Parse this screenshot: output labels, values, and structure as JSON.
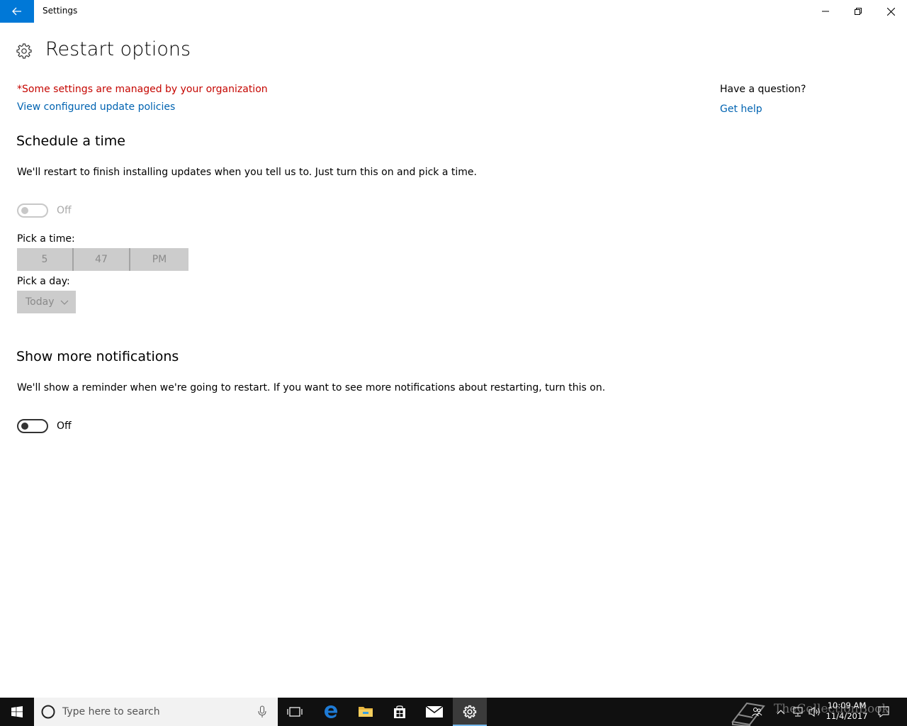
{
  "window": {
    "title": "Settings"
  },
  "page": {
    "title": "Restart options"
  },
  "policy": {
    "managed_note": "*Some settings are managed by your organization",
    "view_policies_link": "View configured update policies"
  },
  "schedule": {
    "heading": "Schedule a time",
    "description": "We'll restart to finish installing updates when you tell us to. Just turn this on and pick a time.",
    "toggle_state": "Off",
    "pick_time_label": "Pick a time:",
    "time": {
      "hour": "5",
      "minute": "47",
      "ampm": "PM"
    },
    "pick_day_label": "Pick a day:",
    "day": "Today"
  },
  "notifications": {
    "heading": "Show more notifications",
    "description": "We'll show a reminder when we're going to restart. If you want to see more notifications about restarting, turn this on.",
    "toggle_state": "Off"
  },
  "help": {
    "question": "Have a question?",
    "get_help_link": "Get help"
  },
  "taskbar": {
    "search_placeholder": "Type here to search",
    "clock_time": "10:09 AM",
    "clock_date": "11/4/2017",
    "watermark": "TheCollectionBook",
    "accent_color": "#0078d7"
  }
}
